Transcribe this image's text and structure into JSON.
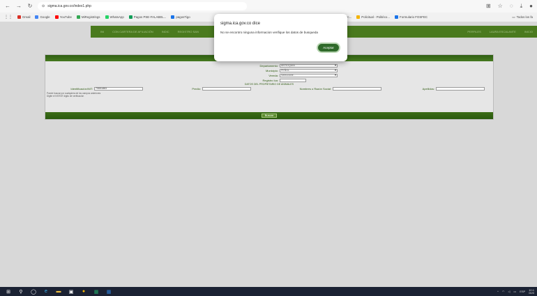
{
  "browser": {
    "url": "sigma.ica.gov.co/index1.php",
    "bookmarks": [
      "Gmail",
      "Google",
      "YouTube",
      "MiRegistrings",
      "WhatsApp",
      "Pagos PSE-FALABEL...",
      "pagosTigo",
      "Anatomía de Mierc...",
      "Policitual - Politéco...",
      "Formulario FOSFEC"
    ],
    "bookmark_colors": [
      "#d93025",
      "#4285f4",
      "#ff0000",
      "#34a853",
      "#25d366",
      "#0f9d58",
      "#1a73e8",
      "#d93025",
      "#f4b400",
      "#1a73e8"
    ],
    "all_bookmarks": "Todos los fa"
  },
  "nav": {
    "left": [
      "INI",
      "CON CARTERA DE AFILIACIÓN",
      "INDIC",
      "REGISTRO SAN"
    ],
    "right": [
      "PERFILES",
      "LAURA ESCALANTE",
      "INICIO"
    ]
  },
  "form": {
    "departamento_label": "Departamento:",
    "departamento_value": "ANTIOQUIA",
    "municipio_label": "Municipio:",
    "municipio_value": "PEÑOL",
    "vereda_label": "Vereda:",
    "vereda_value": "Seleccione...",
    "registro_label": "Registro Ica:",
    "section_title": "DATOS DEL PROPIETARIO DE ANIMALES",
    "identificacion_label": "Identificación/NIT:",
    "identificacion_value": "70651863",
    "predio_label": "Predio:",
    "nombres_label": "Nombres o Razón Social:",
    "apellidos_label": "Apellidos:",
    "hint_line1": "Puede buscar por cualquiera de los campos anteriores",
    "hint_line2": "Digite el NIT/NIT digito de verificación",
    "buscar": "Buscar"
  },
  "dialog": {
    "title": "sigma.ica.gov.co dice",
    "message": "No se encontro ninguna informacion verifique los datos de busqueda",
    "ok": "Aceptar"
  },
  "taskbar": {
    "lang": "ESP",
    "time": "10:1",
    "date": "00/0"
  }
}
